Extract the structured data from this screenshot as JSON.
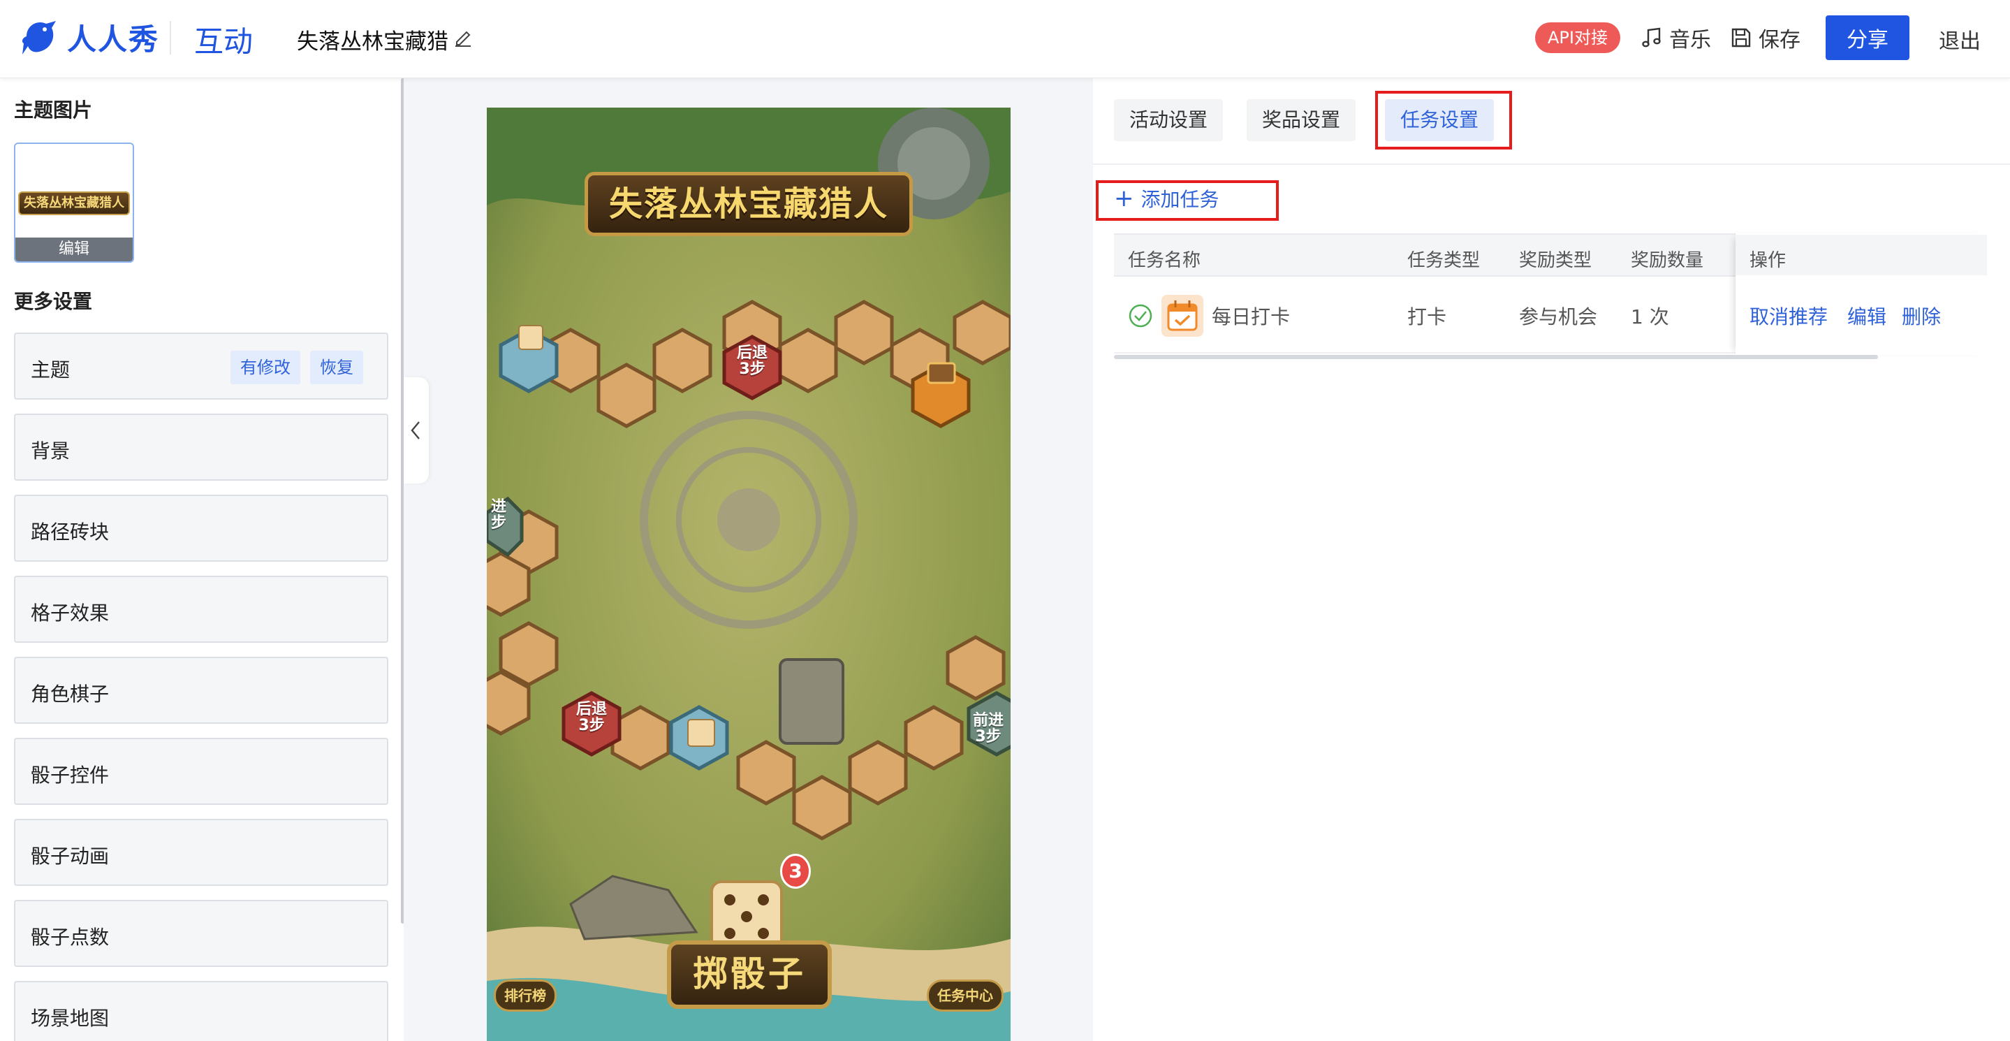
{
  "header": {
    "brand": "人人秀",
    "module": "互动",
    "project_title": "失落丛林宝藏猎",
    "api_badge": "API对接",
    "music_label": "音乐",
    "save_label": "保存",
    "share_label": "分享",
    "exit_label": "退出",
    "brand_color": "#1f55e0",
    "icons": [
      "bird-logo-icon",
      "pencil-edit-icon",
      "music-note-icon",
      "floppy-save-icon"
    ]
  },
  "left_panel": {
    "theme_image_title": "主题图片",
    "thumb_text": "失落丛林宝藏猎人",
    "thumb_edit_label": "编辑",
    "more_settings_title": "更多设置",
    "settings": [
      {
        "label": "主题",
        "tag_modified": "有修改",
        "tag_restore": "恢复"
      },
      {
        "label": "背景"
      },
      {
        "label": "路径砖块"
      },
      {
        "label": "格子效果"
      },
      {
        "label": "角色棋子"
      },
      {
        "label": "骰子控件"
      },
      {
        "label": "骰子动画"
      },
      {
        "label": "骰子点数"
      },
      {
        "label": "场景地图"
      }
    ]
  },
  "preview": {
    "game_title": "失落丛林宝藏猎人",
    "tile_back_3": "后退\n3步",
    "tile_forward_3": "前进\n3步",
    "tile_forward_partial": "进\n步",
    "roll_button": "掷骰子",
    "leaderboard": "排行榜",
    "task_center": "任务中心",
    "dice_count": "3"
  },
  "right_panel": {
    "tabs": [
      "活动设置",
      "奖品设置",
      "任务设置"
    ],
    "active_tab": "任务设置",
    "add_task_label": "添加任务",
    "table": {
      "headers": [
        "任务名称",
        "任务类型",
        "奖励类型",
        "奖励数量",
        "操作"
      ],
      "rows": [
        {
          "name": "每日打卡",
          "type": "打卡",
          "reward_type": "参与机会",
          "reward_qty": "1 次",
          "actions": [
            "取消推荐",
            "编辑",
            "删除"
          ]
        }
      ]
    },
    "highlight_color": "#e41c1c",
    "accent_color": "#2f62d9"
  }
}
